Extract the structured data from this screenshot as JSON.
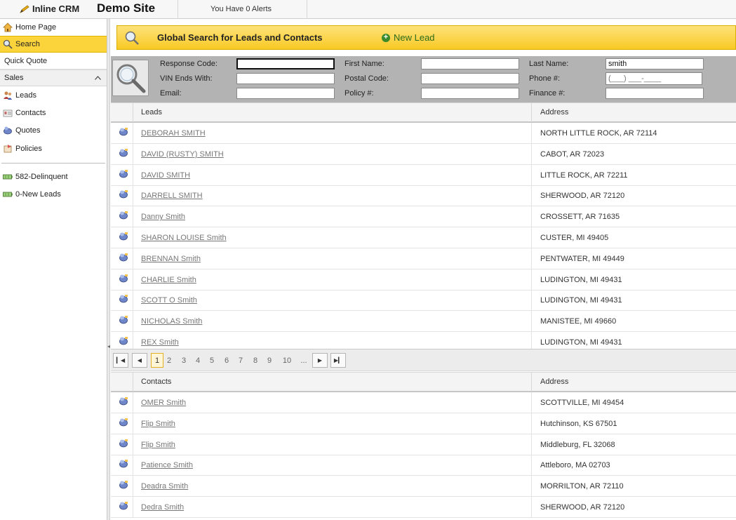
{
  "app": {
    "brand": "Inline CRM",
    "site_name": "Demo Site",
    "alerts": "You Have 0 Alerts"
  },
  "sidebar": {
    "home": "Home Page",
    "search": "Search",
    "quick_quote": "Quick Quote",
    "sales_group": "Sales",
    "leads": "Leads",
    "contacts": "Contacts",
    "quotes": "Quotes",
    "policies": "Policies",
    "delinquent": "582-Delinquent",
    "new_leads": "0-New Leads"
  },
  "banner": {
    "title": "Global Search for Leads and Contacts",
    "new_lead": "New Lead"
  },
  "form": {
    "response_code_label": "Response Code:",
    "response_code_value": "",
    "vin_label": "VIN Ends With:",
    "vin_value": "",
    "email_label": "Email:",
    "email_value": "",
    "first_name_label": "First Name:",
    "first_name_value": "",
    "postal_code_label": "Postal Code:",
    "postal_code_value": "",
    "policy_label": "Policy #:",
    "policy_value": "",
    "last_name_label": "Last Name:",
    "last_name_value": "smith",
    "phone_label": "Phone #:",
    "phone_placeholder": "(___) ___-____",
    "finance_label": "Finance #:",
    "finance_value": ""
  },
  "leads_grid": {
    "col_name": "Leads",
    "col_address": "Address",
    "rows": [
      {
        "name": "DEBORAH SMITH",
        "address": "NORTH LITTLE ROCK, AR 72114"
      },
      {
        "name": "DAVID (RUSTY) SMITH",
        "address": "CABOT, AR 72023"
      },
      {
        "name": "DAVID SMITH",
        "address": "LITTLE ROCK, AR 72211"
      },
      {
        "name": "DARRELL SMITH",
        "address": "SHERWOOD, AR 72120"
      },
      {
        "name": "Danny Smith",
        "address": "CROSSETT, AR 71635"
      },
      {
        "name": "SHARON LOUISE Smith",
        "address": "CUSTER, MI 49405"
      },
      {
        "name": "BRENNAN Smith",
        "address": "PENTWATER, MI 49449"
      },
      {
        "name": "CHARLIE Smith",
        "address": "LUDINGTON, MI 49431"
      },
      {
        "name": "SCOTT O Smith",
        "address": "LUDINGTON, MI 49431"
      },
      {
        "name": "NICHOLAS Smith",
        "address": "MANISTEE, MI 49660"
      },
      {
        "name": "REX Smith",
        "address": "LUDINGTON, MI 49431"
      }
    ]
  },
  "pager": {
    "pages": [
      "1",
      "2",
      "3",
      "4",
      "5",
      "6",
      "7",
      "8",
      "9",
      "10",
      "..."
    ],
    "current": "1"
  },
  "contacts_grid": {
    "col_name": "Contacts",
    "col_address": "Address",
    "rows": [
      {
        "name": "OMER Smith",
        "address": "SCOTTVILLE, MI 49454"
      },
      {
        "name": "Flip Smith",
        "address": "Hutchinson, KS 67501"
      },
      {
        "name": "Flip Smith",
        "address": "Middleburg, FL 32068"
      },
      {
        "name": "Patience Smith",
        "address": "Attleboro, MA 02703"
      },
      {
        "name": "Deadra Smith",
        "address": "MORRILTON, AR 72110"
      },
      {
        "name": "Dedra Smith",
        "address": "SHERWOOD, AR 72120"
      }
    ]
  },
  "colors": {
    "accent_yellow": "#fbd43c",
    "banner_green": "#2b6a1d"
  }
}
